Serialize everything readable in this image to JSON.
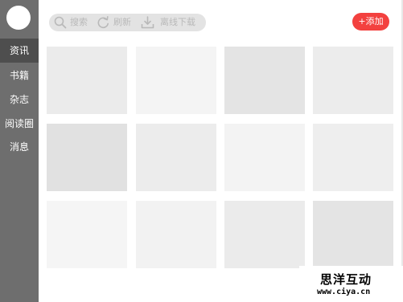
{
  "sidebar": {
    "items": [
      {
        "label": "资讯"
      },
      {
        "label": "书籍"
      },
      {
        "label": "杂志"
      },
      {
        "label": "阅读圈"
      },
      {
        "label": "消息"
      }
    ]
  },
  "toolbar": {
    "search_label": "搜索",
    "refresh_label": "刷新",
    "offline_label": "离线下载",
    "add_label": "+添加"
  },
  "grid": {
    "tile_colors": [
      "#ebebeb",
      "#f4f4f4",
      "#e4e4e4",
      "#ececec",
      "#e1e1e1",
      "#ececec",
      "#f3f3f3",
      "#eeeeee",
      "#f5f5f5",
      "#f2f2f2",
      "#ebebeb",
      "#e4e4e4"
    ]
  },
  "watermark": {
    "brand_cn": "思洋互动",
    "url": "www.ciya.cn"
  }
}
